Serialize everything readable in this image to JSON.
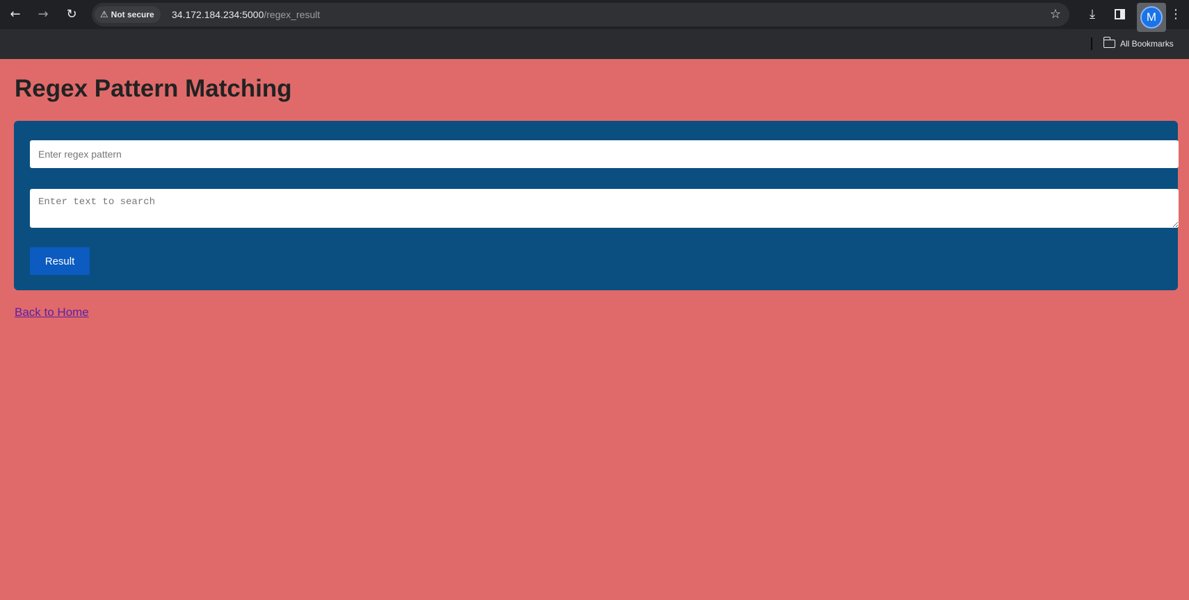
{
  "browser": {
    "security_label": "Not secure",
    "url_host": "34.172.184.234:5000",
    "url_path": "/regex_result",
    "profile_initial": "M",
    "bookmarks_label": "All Bookmarks",
    "icons": [
      "back-arrow-icon",
      "forward-arrow-icon",
      "reload-icon",
      "warning-icon",
      "star-icon",
      "download-icon",
      "side-panel-icon",
      "menu-dots-icon",
      "folder-icon"
    ]
  },
  "page": {
    "title": "Regex Pattern Matching",
    "pattern_placeholder": "Enter regex pattern",
    "text_placeholder": "Enter text to search",
    "submit_label": "Result",
    "back_link": "Back to Home"
  },
  "colors": {
    "page_background": "#e06a6a",
    "card_background": "#0b4f80",
    "button": "#0b5bc0"
  }
}
